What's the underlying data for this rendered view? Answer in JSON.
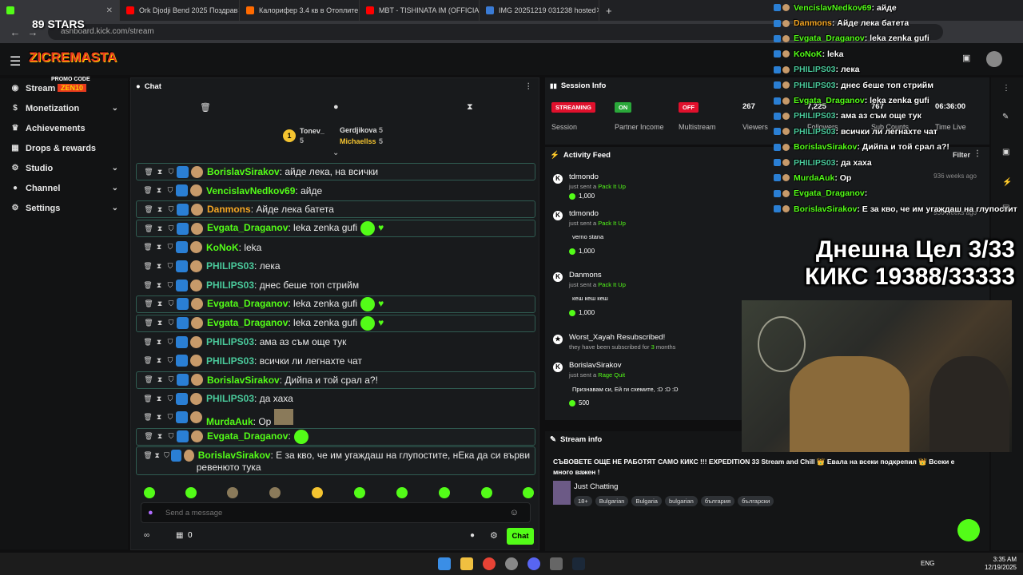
{
  "browser": {
    "tabs": [
      {
        "label": "",
        "color": "#53fc18"
      },
      {
        "label": "Ork Djodji Bend 2025 Поздрав",
        "color": "#ff0000"
      },
      {
        "label": "Калорифер 3.4 кв в Отоплите",
        "color": "#ff6a00"
      },
      {
        "label": "MBT - TISHINATA IM (OFFICIAL",
        "color": "#ff0000"
      },
      {
        "label": "IMG 20251219 031238 hosted",
        "color": "#3a7bd5"
      }
    ],
    "url": "ashboard.kick.com/stream"
  },
  "nav": {
    "items": [
      {
        "label": "Stream",
        "icon": "broadcast-icon",
        "glyph": "((·))",
        "chevron": false
      },
      {
        "label": "Monetization",
        "icon": "dollar-icon",
        "glyph": "$",
        "chevron": true
      },
      {
        "label": "Achievements",
        "icon": "trophy-icon",
        "glyph": "🏆",
        "chevron": false
      },
      {
        "label": "Drops & rewards",
        "icon": "gift-icon",
        "glyph": "▦",
        "chevron": false
      },
      {
        "label": "Studio",
        "icon": "gear-icon",
        "glyph": "⚙",
        "chevron": true
      },
      {
        "label": "Channel",
        "icon": "user-icon",
        "glyph": "👤",
        "chevron": true
      },
      {
        "label": "Settings",
        "icon": "settings-icon",
        "glyph": "⚙",
        "chevron": true
      }
    ]
  },
  "chat": {
    "title": "Chat",
    "leaderboard": {
      "first": {
        "name": "Tonev_",
        "count": "5"
      },
      "second": {
        "name": "Gerdjikova",
        "count": "5"
      },
      "third": {
        "name": "Michaellss",
        "count": "5"
      }
    },
    "messages": [
      {
        "user": "BorislavSirakov",
        "text": ": айде лека, на всички",
        "color": "#53fc18",
        "boxed": true,
        "extra": ""
      },
      {
        "user": "VencislavNedkov69",
        "text": ": айде",
        "color": "#53fc18",
        "boxed": false,
        "extra": ""
      },
      {
        "user": "Danmons",
        "text": ": Айде лека батета",
        "color": "#f5a623",
        "boxed": true,
        "extra": ""
      },
      {
        "user": "Evgata_Draganov",
        "text": ": leka zenka gufi",
        "color": "#53fc18",
        "boxed": true,
        "extra": "emote-heart"
      },
      {
        "user": "KoNoK",
        "text": ": leka",
        "color": "#53fc18",
        "boxed": false,
        "extra": ""
      },
      {
        "user": "PHILIPS03",
        "text": ": лека",
        "color": "#4ac99b",
        "boxed": false,
        "extra": ""
      },
      {
        "user": "PHILIPS03",
        "text": ": днес беше топ стрийм",
        "color": "#4ac99b",
        "boxed": false,
        "extra": ""
      },
      {
        "user": "Evgata_Draganov",
        "text": ": leka zenka gufi",
        "color": "#53fc18",
        "boxed": true,
        "extra": "emote-heart"
      },
      {
        "user": "Evgata_Draganov",
        "text": ": leka zenka gufi",
        "color": "#53fc18",
        "boxed": true,
        "extra": "emote-heart"
      },
      {
        "user": "PHILIPS03",
        "text": ": ама аз съм още тук",
        "color": "#4ac99b",
        "boxed": false,
        "extra": ""
      },
      {
        "user": "PHILIPS03",
        "text": ": всички ли легнахте чат",
        "color": "#4ac99b",
        "boxed": false,
        "extra": ""
      },
      {
        "user": "BorislavSirakov",
        "text": ": Дийпа и той срал а?!",
        "color": "#53fc18",
        "boxed": true,
        "extra": ""
      },
      {
        "user": "PHILIPS03",
        "text": ": да хаха",
        "color": "#4ac99b",
        "boxed": false,
        "extra": ""
      },
      {
        "user": "MurdaAuk",
        "text": ": Ор",
        "color": "#53fc18",
        "boxed": false,
        "extra": "photo"
      },
      {
        "user": "Evgata_Draganov",
        "text": ":",
        "color": "#53fc18",
        "boxed": true,
        "extra": "emote"
      },
      {
        "user": "BorislavSirakov",
        "text": ": Е за кво, че им угаждаш на глупостите, нЕка да си върви ревенюто тука",
        "color": "#53fc18",
        "boxed": true,
        "extra": "tall"
      }
    ],
    "input_placeholder": "Send a message",
    "bottom_count": "0",
    "chat_button": "Chat"
  },
  "session": {
    "title": "Session Info",
    "stats": [
      {
        "badge": "STREAMING",
        "badge_color": "#e0102c",
        "label": "Session"
      },
      {
        "badge": "ON",
        "badge_color": "#2aa83a",
        "label": "Partner Income"
      },
      {
        "badge": "OFF",
        "badge_color": "#e0102c",
        "label": "Multistream"
      },
      {
        "badge": "267",
        "badge_color": "",
        "label": "Viewers"
      },
      {
        "badge": "7,225",
        "badge_color": "",
        "label": "Followers"
      },
      {
        "badge": "767",
        "badge_color": "",
        "label": "Sub Counts"
      },
      {
        "badge": "06:36:00",
        "badge_color": "",
        "label": "Time Live"
      }
    ]
  },
  "activity": {
    "title": "Activity Feed",
    "filter": "Filter",
    "items": [
      {
        "name": "tdmondo",
        "pre": "just sent a ",
        "action": "Pack It Up",
        "note": "",
        "amount": "1,000",
        "ago": "936 weeks ago"
      },
      {
        "name": "tdmondo",
        "pre": "just sent a ",
        "action": "Pack It Up",
        "note": "verno stana",
        "amount": "1,000",
        "ago": "936 weeks ago"
      },
      {
        "name": "Danmons",
        "pre": "just sent a ",
        "action": "Pack It Up",
        "note": "кеш кеш кеш",
        "amount": "1,000",
        "ago": ""
      },
      {
        "name": "Worst_Xayah Resubscribed!",
        "pre": "they have been subscribed for ",
        "action": "3",
        "post": " months",
        "note": "",
        "amount": "",
        "ago": ""
      },
      {
        "name": "BorislavSirakov",
        "pre": "just sent a ",
        "action": "Rage Quit",
        "note": "Признавам си, Ей ги схемите, :D :D :D",
        "amount": "500",
        "ago": ""
      }
    ]
  },
  "stream_info": {
    "title": "Stream info",
    "stream_title": "СЪВОВЕТЕ ОЩЕ НЕ РАБОТЯТ САМО КИКС !!! EXPEDITION 33 Stream and Chill 👑 Евала на всеки подкрепил 👑 Всеки е много важен !",
    "category": "Just Chatting",
    "tags": [
      "18+",
      "Bulgarian",
      "Bulgaria",
      "bulgarian",
      "българия",
      "български"
    ]
  },
  "overlay": {
    "chat": [
      {
        "user": "VencislavNedkov69",
        "text": ": айде",
        "color": "#53fc18"
      },
      {
        "user": "Danmons",
        "text": ": Айде лека батета",
        "color": "#f5a623"
      },
      {
        "user": "Evgata_Draganov",
        "text": ": leka zenka gufi",
        "color": "#53fc18"
      },
      {
        "user": "KoNoK",
        "text": ": leka",
        "color": "#53fc18"
      },
      {
        "user": "PHILIPS03",
        "text": ": лека",
        "color": "#4ac99b"
      },
      {
        "user": "PHILIPS03",
        "text": ": днес беше топ стрийм",
        "color": "#4ac99b"
      },
      {
        "user": "Evgata_Draganov",
        "text": ": leka zenka gufi",
        "color": "#53fc18"
      },
      {
        "user": "PHILIPS03",
        "text": ": ама аз съм още тук",
        "color": "#4ac99b"
      },
      {
        "user": "PHILIPS03",
        "text": ": всички ли легнахте чат",
        "color": "#4ac99b"
      },
      {
        "user": "BorislavSirakov",
        "text": ": Дийпа и той срал а?!",
        "color": "#53fc18"
      },
      {
        "user": "PHILIPS03",
        "text": ": да хаха",
        "color": "#4ac99b"
      },
      {
        "user": "MurdaAuk",
        "text": ": Ор",
        "color": "#53fc18"
      },
      {
        "user": "Evgata_Draganov",
        "text": ":",
        "color": "#53fc18"
      },
      {
        "user": "BorislavSirakov",
        "text": ": Е за кво, че им угаждаш на глупостит",
        "color": "#53fc18"
      }
    ],
    "goal_line1": "Днешна Цел 3/33",
    "goal_line2": "КИКС 19388/33333",
    "logo_top": "89 STARS",
    "logo_main": "ZICREMASTA",
    "logo_promo": "PROMO CODE",
    "logo_code": "ZEN10"
  },
  "taskbar": {
    "lang": "ENG",
    "time": "3:35 AM",
    "date": "12/19/2025"
  },
  "colors": {
    "accent": "#53fc18",
    "live_red": "#e0102c"
  }
}
